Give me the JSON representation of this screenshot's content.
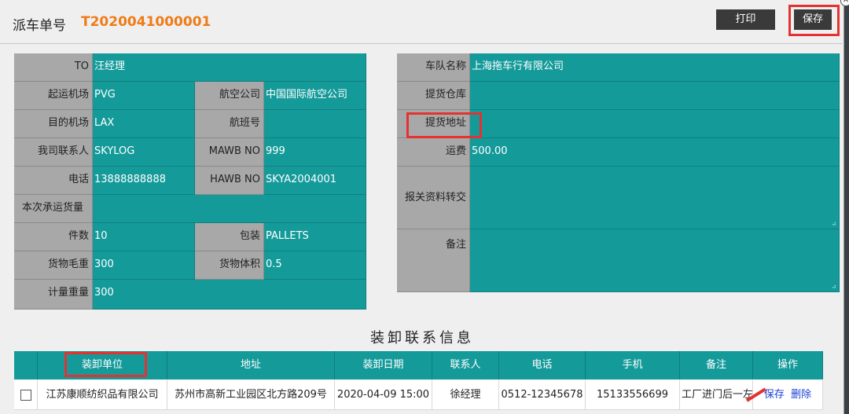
{
  "header": {
    "title": "派车单号",
    "order_number": "T2020041000001"
  },
  "toolbar": {
    "print_label": "打印",
    "save_label": "保存"
  },
  "left_form": {
    "to": {
      "label": "TO",
      "value": "汪经理"
    },
    "origin_airport": {
      "label": "起运机场",
      "value": "PVG"
    },
    "airline": {
      "label": "航空公司",
      "value": "中国国际航空公司"
    },
    "dest_airport": {
      "label": "目的机场",
      "value": "LAX"
    },
    "flight_no": {
      "label": "航班号",
      "value": ""
    },
    "contact": {
      "label": "我司联系人",
      "value": "SKYLOG"
    },
    "mawb": {
      "label": "MAWB NO",
      "value": "999"
    },
    "phone": {
      "label": "电话",
      "value": "13888888888"
    },
    "hawb": {
      "label": "HAWB NO",
      "value": "SKYA2004001"
    },
    "cargo_volume_this": {
      "label": "本次承运货量",
      "value": ""
    },
    "pieces": {
      "label": "件数",
      "value": "10"
    },
    "packing": {
      "label": "包装",
      "value": "PALLETS"
    },
    "gross_weight": {
      "label": "货物毛重",
      "value": "300"
    },
    "volume": {
      "label": "货物体积",
      "value": "0.5"
    },
    "chargeable_weight": {
      "label": "计量重量",
      "value": "300"
    }
  },
  "right_form": {
    "fleet_name": {
      "label": "车队名称",
      "value": "上海拖车行有限公司"
    },
    "pickup_warehouse": {
      "label": "提货仓库",
      "value": ""
    },
    "pickup_address": {
      "label": "提货地址",
      "value": ""
    },
    "freight": {
      "label": "运费",
      "value": "500.00"
    },
    "customs_docs": {
      "label": "报关资料转交",
      "value": ""
    },
    "remarks": {
      "label": "备注",
      "value": ""
    }
  },
  "section": {
    "title": "装卸联系信息"
  },
  "table": {
    "columns": [
      "",
      "装卸单位",
      "地址",
      "装卸日期",
      "联系人",
      "电话",
      "手机",
      "备注",
      "操作"
    ],
    "rows": [
      {
        "unit": "江苏康顺纺织品有限公司",
        "address": "苏州市高新工业园区北方路209号",
        "date": "2020-04-09 15:00",
        "contact": "徐经理",
        "phone": "0512-12345678",
        "mobile": "15133556699",
        "remark": "工厂进门后一左",
        "action_save": "保存",
        "action_delete": "删除"
      }
    ]
  },
  "colors": {
    "teal": "#159a9a",
    "label_gray": "#a8a8a8",
    "accent_orange": "#f07b15",
    "highlight_red": "#e43232",
    "link_blue": "#1a3fd6"
  }
}
